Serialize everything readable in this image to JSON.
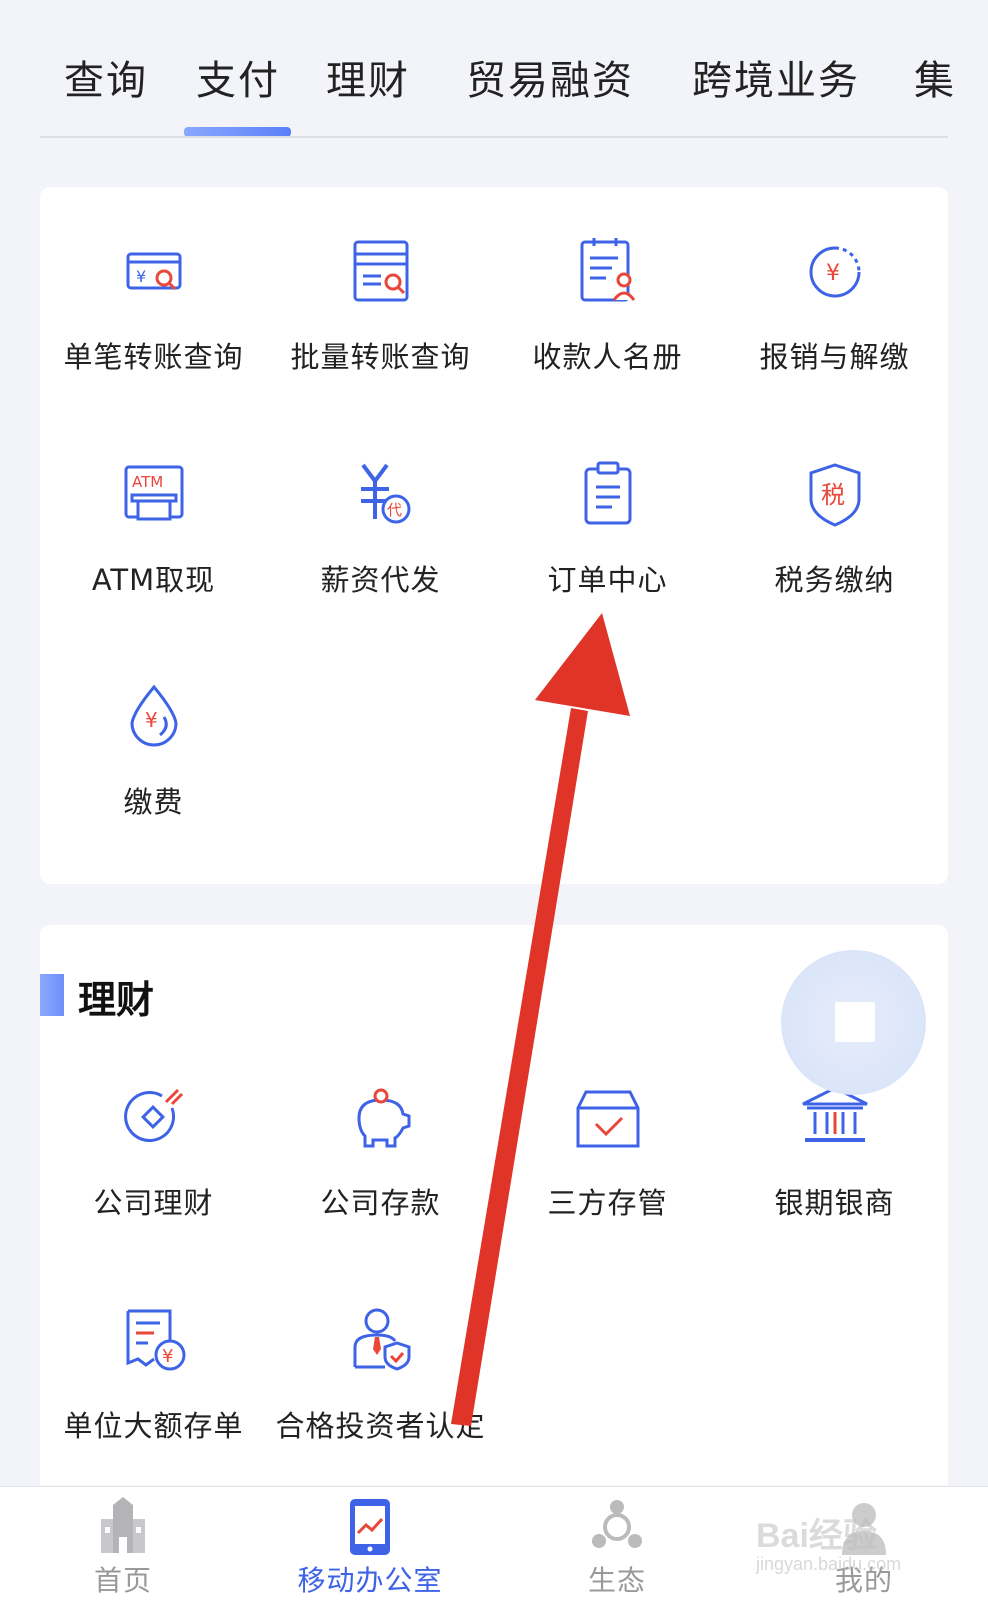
{
  "tabs": [
    "查询",
    "支付",
    "理财",
    "贸易融资",
    "跨境业务",
    "集"
  ],
  "active_tab": "支付",
  "payment_items": [
    {
      "label": "单笔转账查询",
      "icon": "card-search-icon"
    },
    {
      "label": "批量转账查询",
      "icon": "batch-search-icon"
    },
    {
      "label": "收款人名册",
      "icon": "payee-list-icon"
    },
    {
      "label": "报销与解缴",
      "icon": "reimburse-icon"
    },
    {
      "label": "ATM取现",
      "icon": "atm-icon",
      "icon_text": "ATM"
    },
    {
      "label": "薪资代发",
      "icon": "salary-icon",
      "icon_text": "代"
    },
    {
      "label": "订单中心",
      "icon": "clipboard-icon"
    },
    {
      "label": "税务缴纳",
      "icon": "tax-icon",
      "icon_text": "税"
    },
    {
      "label": "缴费",
      "icon": "fee-drop-icon"
    }
  ],
  "wealth_section": {
    "title": "理财",
    "items": [
      {
        "label": "公司理财",
        "icon": "finance-icon"
      },
      {
        "label": "公司存款",
        "icon": "piggy-bank-icon"
      },
      {
        "label": "三方存管",
        "icon": "custody-box-icon"
      },
      {
        "label": "银期银商",
        "icon": "bank-building-icon"
      },
      {
        "label": "单位大额存单",
        "icon": "certificate-icon"
      },
      {
        "label": "合格投资者认定",
        "icon": "investor-icon"
      }
    ]
  },
  "bottom_nav": [
    {
      "label": "首页",
      "icon": "home-building-icon",
      "active": false
    },
    {
      "label": "移动办公室",
      "icon": "mobile-office-icon",
      "active": true
    },
    {
      "label": "生态",
      "icon": "ecosystem-icon",
      "active": false
    },
    {
      "label": "我的",
      "icon": "profile-icon",
      "active": false
    }
  ],
  "watermark": {
    "text": "Bai经验",
    "sub": "jingyan.baidu.com"
  },
  "colors": {
    "primary": "#3e63e6",
    "accent_red": "#e8473a",
    "arrow": "#e03428"
  }
}
